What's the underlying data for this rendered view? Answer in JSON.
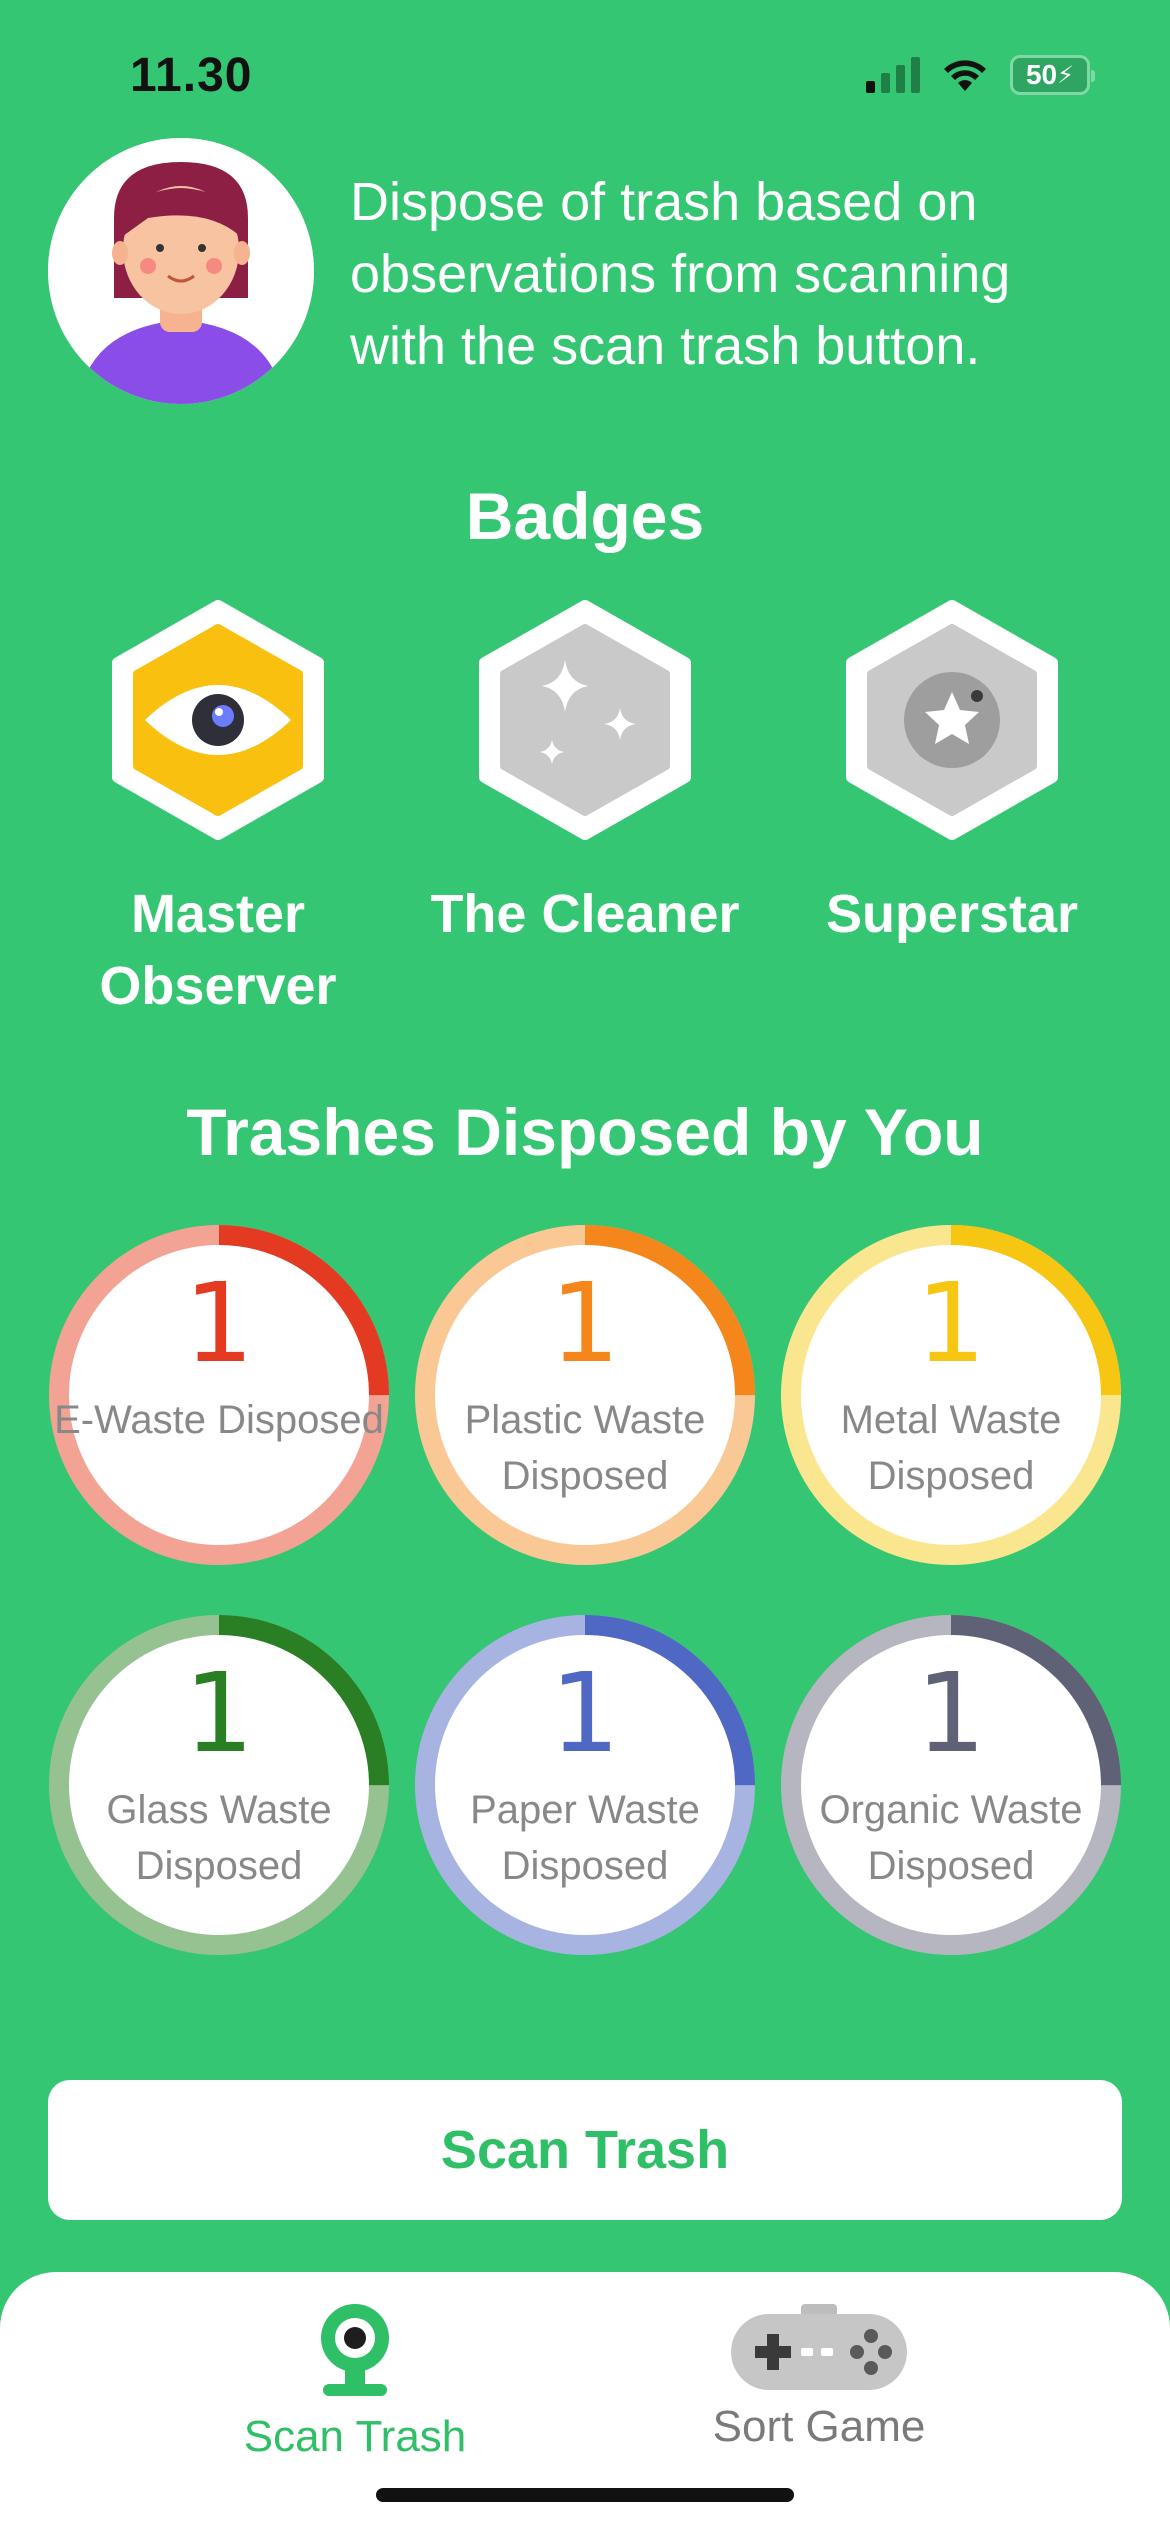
{
  "status_bar": {
    "time": "11.30",
    "battery": "50"
  },
  "header": {
    "description": "Dispose of trash based on observations from scanning with the scan trash button."
  },
  "badges_section": {
    "title": "Badges",
    "items": [
      {
        "label": "Master Observer",
        "icon": "eye-icon",
        "unlocked": true
      },
      {
        "label": "The Cleaner",
        "icon": "sparkles-icon",
        "unlocked": false
      },
      {
        "label": "Superstar",
        "icon": "star-icon",
        "unlocked": false
      }
    ]
  },
  "stats_section": {
    "title": "Trashes Disposed by You",
    "items": [
      {
        "count": "1",
        "label": "E-Waste Disposed",
        "color": "#e53a22",
        "track": "#f2a394",
        "progress": 0.25
      },
      {
        "count": "1",
        "label": "Plastic Waste Disposed",
        "color": "#f4861c",
        "track": "#f9c894",
        "progress": 0.25
      },
      {
        "count": "1",
        "label": "Metal Waste Disposed",
        "color": "#f7c613",
        "track": "#fbe690",
        "progress": 0.25
      },
      {
        "count": "1",
        "label": "Glass Waste Disposed",
        "color": "#2a7f24",
        "track": "#95c290",
        "progress": 0.25
      },
      {
        "count": "1",
        "label": "Paper Waste Disposed",
        "color": "#4f68c4",
        "track": "#a7b4e2",
        "progress": 0.25
      },
      {
        "count": "1",
        "label": "Organic Waste Disposed",
        "color": "#5f6276",
        "track": "#b5b6bf",
        "progress": 0.25
      }
    ]
  },
  "scan_button": {
    "label": "Scan Trash"
  },
  "tab_bar": {
    "tabs": [
      {
        "label": "Scan Trash",
        "icon": "webcam-icon",
        "active": true,
        "color": "#2fbf66"
      },
      {
        "label": "Sort Game",
        "icon": "gamepad-icon",
        "active": false,
        "color": "#7a7a7a"
      }
    ]
  }
}
